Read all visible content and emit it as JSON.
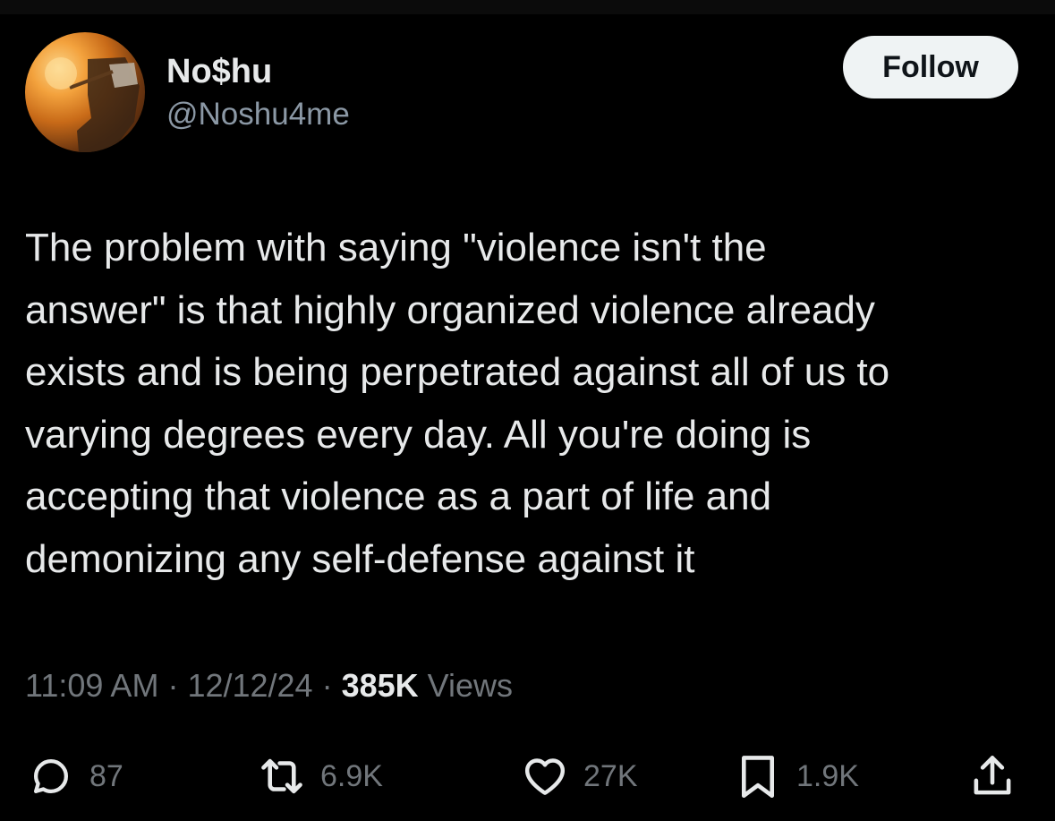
{
  "author": {
    "display_name": "No$hu",
    "handle": "@Noshu4me"
  },
  "follow_button": {
    "label": "Follow"
  },
  "tweet": {
    "text": "The problem with saying \"violence isn't the\nanswer\" is that highly organized violence already\nexists and is being perpetrated against all of us to\nvarying degrees every day. All you're doing is\naccepting that violence as a part of life and\ndemonizing any self-defense against it"
  },
  "meta": {
    "time": "11:09 AM",
    "separator": " · ",
    "date": "12/12/24",
    "views_count": "385K",
    "views_label": "Views"
  },
  "actions": {
    "replies": {
      "icon": "reply-icon",
      "count": "87"
    },
    "reposts": {
      "icon": "repost-icon",
      "count": "6.9K"
    },
    "likes": {
      "icon": "heart-icon",
      "count": "27K"
    },
    "bookmarks": {
      "icon": "bookmark-icon",
      "count": "1.9K"
    },
    "share": {
      "icon": "share-icon"
    }
  },
  "colors": {
    "background": "#000000",
    "text_primary": "#e7e9ea",
    "text_secondary": "#71767b",
    "follow_bg": "#eff3f4"
  }
}
